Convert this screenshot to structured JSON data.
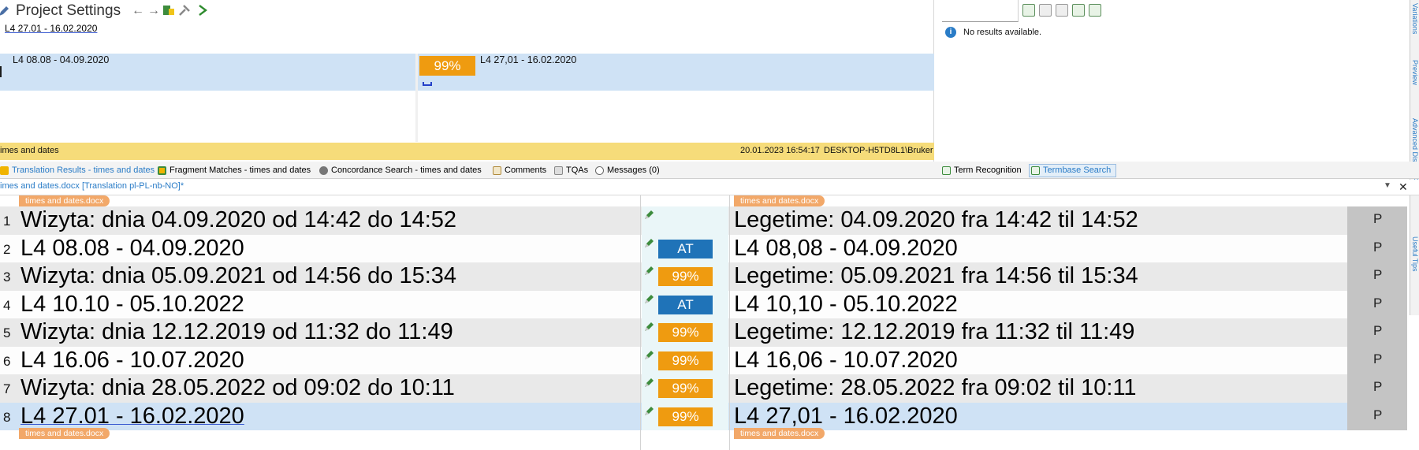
{
  "translation_results": {
    "pane_title": "Project Settings",
    "source_preview": "L4 27.01 - 16.02.2020",
    "match": {
      "source": "L4 08.08 - 04.09.2020",
      "score": "99%",
      "target": "L4 27,01 - 16.02.2020"
    },
    "status_bar": {
      "file": "imes and dates",
      "date": "20.01.2023 16:54:17",
      "user": "DESKTOP-H5TD8L1\\Bruker"
    }
  },
  "termbase": {
    "no_results": "No results available."
  },
  "side_tabs": [
    "Variations",
    "Preview",
    "Advanced Display Filter",
    "Useful Tips"
  ],
  "tabs": [
    {
      "label": "Translation Results - times and dates",
      "active": true
    },
    {
      "label": "Fragment Matches - times and dates",
      "active": false
    },
    {
      "label": "Concordance Search - times and dates",
      "active": false
    },
    {
      "label": "Comments",
      "active": false
    },
    {
      "label": "TQAs",
      "active": false
    },
    {
      "label": "Messages (0)",
      "active": false
    },
    {
      "label": "Term Recognition",
      "active": false
    },
    {
      "label": "Termbase Search",
      "active": true
    }
  ],
  "document": {
    "tab_label": "imes and dates.docx [Translation pl-PL-nb-NO]*",
    "file_tag": "times and dates.docx"
  },
  "segments": [
    {
      "num": "1",
      "source": "Wizyta: dnia 04.09.2020 od 14:42 do 14:52",
      "badge": "",
      "badge_type": "",
      "target": "Legetime: 04.09.2020 fra 14:42 til 14:52",
      "lock": "P"
    },
    {
      "num": "2",
      "source": "L4 08.08 - 04.09.2020",
      "badge": "AT",
      "badge_type": "at",
      "target": "L4 08,08 - 04.09.2020",
      "lock": "P"
    },
    {
      "num": "3",
      "source": "Wizyta: dnia 05.09.2021 od 14:56 do 15:34",
      "badge": "99%",
      "badge_type": "pct",
      "target": "Legetime: 05.09.2021 fra 14:56 til 15:34",
      "lock": "P"
    },
    {
      "num": "4",
      "source": "L4 10.10 - 05.10.2022",
      "badge": "AT",
      "badge_type": "at",
      "target": "L4 10,10 - 05.10.2022",
      "lock": "P"
    },
    {
      "num": "5",
      "source": "Wizyta: dnia 12.12.2019 od 11:32 do 11:49",
      "badge": "99%",
      "badge_type": "pct",
      "target": "Legetime: 12.12.2019 fra 11:32 til 11:49",
      "lock": "P"
    },
    {
      "num": "6",
      "source": "L4 16.06 - 10.07.2020",
      "badge": "99%",
      "badge_type": "pct",
      "target": "L4 16,06 - 10.07.2020",
      "lock": "P"
    },
    {
      "num": "7",
      "source": "Wizyta: dnia 28.05.2022 od 09:02 do 10:11",
      "badge": "99%",
      "badge_type": "pct",
      "target": "Legetime: 28.05.2022 fra 09:02 til 10:11",
      "lock": "P"
    },
    {
      "num": "8",
      "source": "L4 27.01 - 16.02.2020",
      "badge": "99%",
      "badge_type": "pct",
      "target": "L4 27,01 - 16.02.2020",
      "lock": "P"
    }
  ],
  "colors": {
    "match_orange": "#ef9b10",
    "at_blue": "#1f73b8",
    "active_row": "#cfe2f5",
    "status_yellow": "#f6dc7a",
    "file_tag": "#f2a869",
    "accent_blue": "#2a7cc7"
  }
}
